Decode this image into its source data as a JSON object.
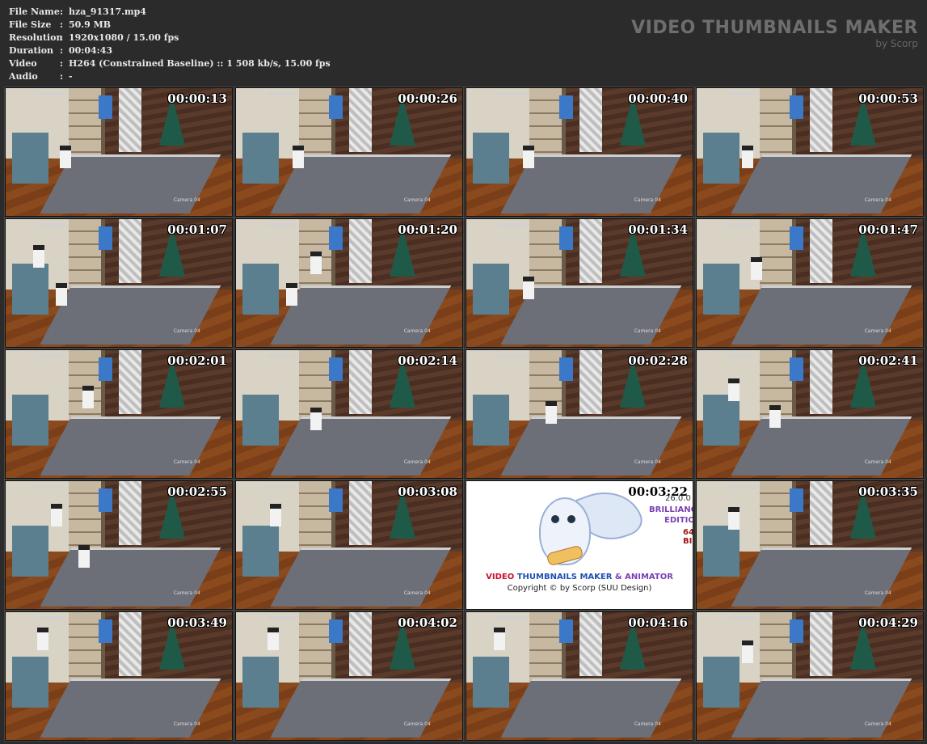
{
  "file_info": [
    {
      "key": "File Name",
      "sep": ":",
      "value": "hza_91317.mp4"
    },
    {
      "key": "File Size",
      "sep": ":",
      "value": "50.9 MB"
    },
    {
      "key": "Resolution",
      "sep": ":",
      "value": "1920x1080 / 15.00 fps"
    },
    {
      "key": "Duration",
      "sep": ":",
      "value": "00:04:43"
    },
    {
      "key": "Video",
      "sep": ":",
      "value": "H264 (Constrained Baseline) :: 1 508 kb/s, 15.00 fps"
    },
    {
      "key": "Audio",
      "sep": ":",
      "value": "-"
    }
  ],
  "brand": {
    "title": "VIDEO THUMBNAILS MAKER",
    "subtitle": "by Scorp"
  },
  "thumbnails": [
    {
      "time": "00:00:13"
    },
    {
      "time": "00:00:26"
    },
    {
      "time": "00:00:40"
    },
    {
      "time": "00:00:53"
    },
    {
      "time": "00:01:07"
    },
    {
      "time": "00:01:20"
    },
    {
      "time": "00:01:34"
    },
    {
      "time": "00:01:47"
    },
    {
      "time": "00:02:01"
    },
    {
      "time": "00:02:14"
    },
    {
      "time": "00:02:28"
    },
    {
      "time": "00:02:41"
    },
    {
      "time": "00:02:55"
    },
    {
      "time": "00:03:08"
    },
    {
      "time": "00:03:22"
    },
    {
      "time": "00:03:35"
    },
    {
      "time": "00:03:49"
    },
    {
      "time": "00:04:02"
    },
    {
      "time": "00:04:16"
    },
    {
      "time": "00:04:29"
    }
  ],
  "promo": {
    "version": "26.0.0",
    "edition_line1": "BRILLIANC",
    "edition_line2": "EDITIO",
    "edition_line3": "64 BI",
    "title_a": "VIDEO",
    "title_b": "THUMBNAILS MAKER",
    "title_c": "& ANIMATOR",
    "copyright": "Copyright © by Scorp (SUU Design)"
  },
  "camera_label": "Camera 04",
  "colors": {
    "background": "#2b2b2b",
    "header_text": "#e8e8e8",
    "brand_text": "#6e6e6e",
    "timestamp": "#ffffff"
  }
}
